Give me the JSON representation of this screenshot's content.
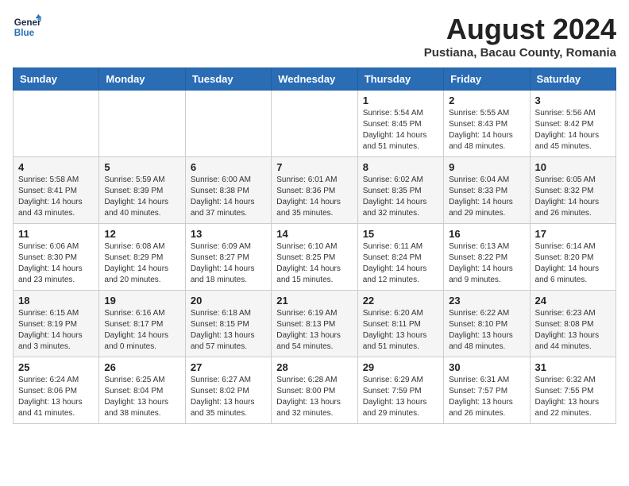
{
  "header": {
    "logo_line1": "General",
    "logo_line2": "Blue",
    "month_year": "August 2024",
    "location": "Pustiana, Bacau County, Romania"
  },
  "weekdays": [
    "Sunday",
    "Monday",
    "Tuesday",
    "Wednesday",
    "Thursday",
    "Friday",
    "Saturday"
  ],
  "weeks": [
    [
      {
        "day": "",
        "info": ""
      },
      {
        "day": "",
        "info": ""
      },
      {
        "day": "",
        "info": ""
      },
      {
        "day": "",
        "info": ""
      },
      {
        "day": "1",
        "info": "Sunrise: 5:54 AM\nSunset: 8:45 PM\nDaylight: 14 hours\nand 51 minutes."
      },
      {
        "day": "2",
        "info": "Sunrise: 5:55 AM\nSunset: 8:43 PM\nDaylight: 14 hours\nand 48 minutes."
      },
      {
        "day": "3",
        "info": "Sunrise: 5:56 AM\nSunset: 8:42 PM\nDaylight: 14 hours\nand 45 minutes."
      }
    ],
    [
      {
        "day": "4",
        "info": "Sunrise: 5:58 AM\nSunset: 8:41 PM\nDaylight: 14 hours\nand 43 minutes."
      },
      {
        "day": "5",
        "info": "Sunrise: 5:59 AM\nSunset: 8:39 PM\nDaylight: 14 hours\nand 40 minutes."
      },
      {
        "day": "6",
        "info": "Sunrise: 6:00 AM\nSunset: 8:38 PM\nDaylight: 14 hours\nand 37 minutes."
      },
      {
        "day": "7",
        "info": "Sunrise: 6:01 AM\nSunset: 8:36 PM\nDaylight: 14 hours\nand 35 minutes."
      },
      {
        "day": "8",
        "info": "Sunrise: 6:02 AM\nSunset: 8:35 PM\nDaylight: 14 hours\nand 32 minutes."
      },
      {
        "day": "9",
        "info": "Sunrise: 6:04 AM\nSunset: 8:33 PM\nDaylight: 14 hours\nand 29 minutes."
      },
      {
        "day": "10",
        "info": "Sunrise: 6:05 AM\nSunset: 8:32 PM\nDaylight: 14 hours\nand 26 minutes."
      }
    ],
    [
      {
        "day": "11",
        "info": "Sunrise: 6:06 AM\nSunset: 8:30 PM\nDaylight: 14 hours\nand 23 minutes."
      },
      {
        "day": "12",
        "info": "Sunrise: 6:08 AM\nSunset: 8:29 PM\nDaylight: 14 hours\nand 20 minutes."
      },
      {
        "day": "13",
        "info": "Sunrise: 6:09 AM\nSunset: 8:27 PM\nDaylight: 14 hours\nand 18 minutes."
      },
      {
        "day": "14",
        "info": "Sunrise: 6:10 AM\nSunset: 8:25 PM\nDaylight: 14 hours\nand 15 minutes."
      },
      {
        "day": "15",
        "info": "Sunrise: 6:11 AM\nSunset: 8:24 PM\nDaylight: 14 hours\nand 12 minutes."
      },
      {
        "day": "16",
        "info": "Sunrise: 6:13 AM\nSunset: 8:22 PM\nDaylight: 14 hours\nand 9 minutes."
      },
      {
        "day": "17",
        "info": "Sunrise: 6:14 AM\nSunset: 8:20 PM\nDaylight: 14 hours\nand 6 minutes."
      }
    ],
    [
      {
        "day": "18",
        "info": "Sunrise: 6:15 AM\nSunset: 8:19 PM\nDaylight: 14 hours\nand 3 minutes."
      },
      {
        "day": "19",
        "info": "Sunrise: 6:16 AM\nSunset: 8:17 PM\nDaylight: 14 hours\nand 0 minutes."
      },
      {
        "day": "20",
        "info": "Sunrise: 6:18 AM\nSunset: 8:15 PM\nDaylight: 13 hours\nand 57 minutes."
      },
      {
        "day": "21",
        "info": "Sunrise: 6:19 AM\nSunset: 8:13 PM\nDaylight: 13 hours\nand 54 minutes."
      },
      {
        "day": "22",
        "info": "Sunrise: 6:20 AM\nSunset: 8:11 PM\nDaylight: 13 hours\nand 51 minutes."
      },
      {
        "day": "23",
        "info": "Sunrise: 6:22 AM\nSunset: 8:10 PM\nDaylight: 13 hours\nand 48 minutes."
      },
      {
        "day": "24",
        "info": "Sunrise: 6:23 AM\nSunset: 8:08 PM\nDaylight: 13 hours\nand 44 minutes."
      }
    ],
    [
      {
        "day": "25",
        "info": "Sunrise: 6:24 AM\nSunset: 8:06 PM\nDaylight: 13 hours\nand 41 minutes."
      },
      {
        "day": "26",
        "info": "Sunrise: 6:25 AM\nSunset: 8:04 PM\nDaylight: 13 hours\nand 38 minutes."
      },
      {
        "day": "27",
        "info": "Sunrise: 6:27 AM\nSunset: 8:02 PM\nDaylight: 13 hours\nand 35 minutes."
      },
      {
        "day": "28",
        "info": "Sunrise: 6:28 AM\nSunset: 8:00 PM\nDaylight: 13 hours\nand 32 minutes."
      },
      {
        "day": "29",
        "info": "Sunrise: 6:29 AM\nSunset: 7:59 PM\nDaylight: 13 hours\nand 29 minutes."
      },
      {
        "day": "30",
        "info": "Sunrise: 6:31 AM\nSunset: 7:57 PM\nDaylight: 13 hours\nand 26 minutes."
      },
      {
        "day": "31",
        "info": "Sunrise: 6:32 AM\nSunset: 7:55 PM\nDaylight: 13 hours\nand 22 minutes."
      }
    ]
  ]
}
